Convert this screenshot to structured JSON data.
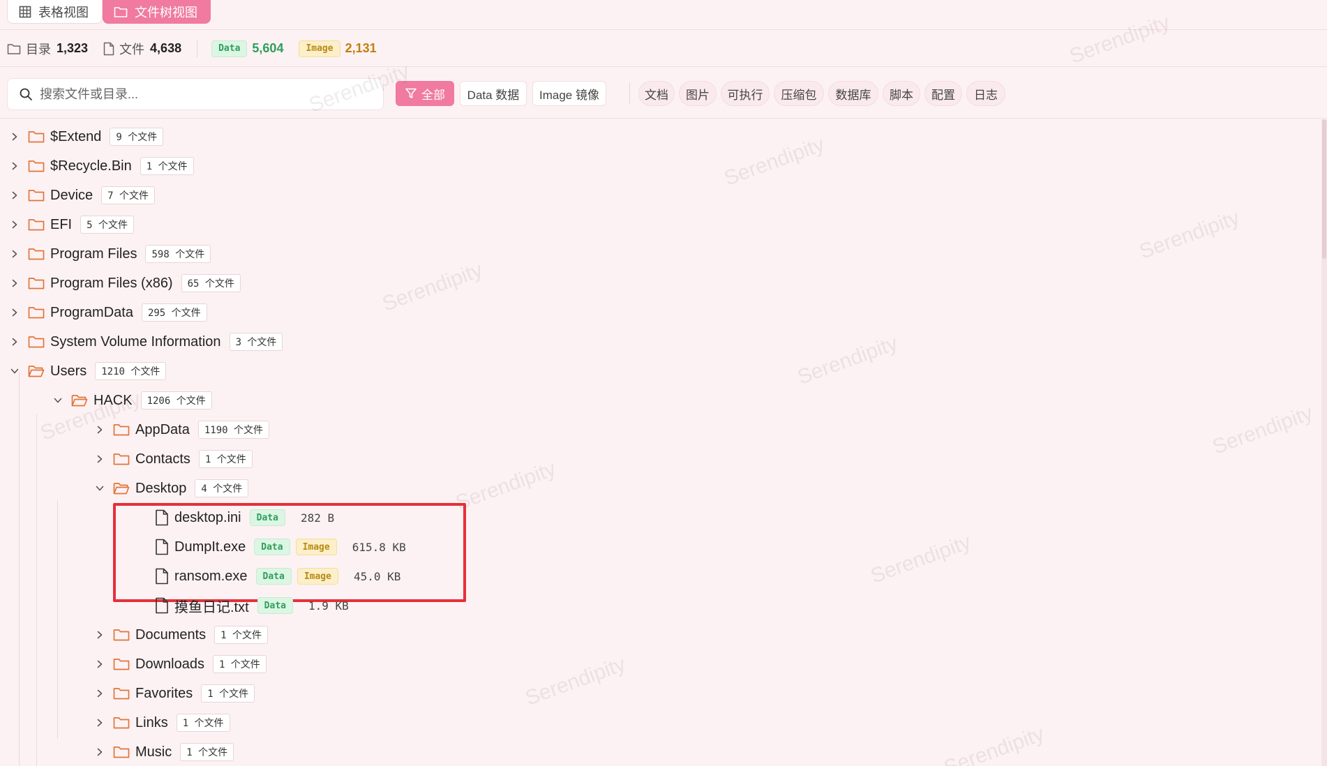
{
  "tabs": [
    {
      "label": "表格视图",
      "active": false
    },
    {
      "label": "文件树视图",
      "active": true
    }
  ],
  "stats": {
    "dir_label": "目录",
    "dir_count": "1,323",
    "file_label": "文件",
    "file_count": "4,638",
    "data_badge": "Data",
    "data_count": "5,604",
    "image_badge": "Image",
    "image_count": "2,131"
  },
  "search": {
    "placeholder": "搜索文件或目录..."
  },
  "filters": {
    "all": "全部",
    "data": "Data 数据",
    "image": "Image 镜像",
    "categories": [
      "文档",
      "图片",
      "可执行",
      "压缩包",
      "数据库",
      "脚本",
      "配置",
      "日志"
    ]
  },
  "tree": {
    "root_items": [
      {
        "name": "$Extend",
        "count": "9 个文件",
        "expanded": false
      },
      {
        "name": "$Recycle.Bin",
        "count": "1 个文件",
        "expanded": false
      },
      {
        "name": "Device",
        "count": "7 个文件",
        "expanded": false
      },
      {
        "name": "EFI",
        "count": "5 个文件",
        "expanded": false
      },
      {
        "name": "Program Files",
        "count": "598 个文件",
        "expanded": false
      },
      {
        "name": "Program Files (x86)",
        "count": "65 个文件",
        "expanded": false
      },
      {
        "name": "ProgramData",
        "count": "295 个文件",
        "expanded": false
      },
      {
        "name": "System Volume Information",
        "count": "3 个文件",
        "expanded": false
      },
      {
        "name": "Users",
        "count": "1210 个文件",
        "expanded": true
      }
    ],
    "hack": {
      "name": "HACK",
      "count": "1206 个文件",
      "expanded": true
    },
    "hack_children": [
      {
        "name": "AppData",
        "count": "1190 个文件",
        "expanded": false
      },
      {
        "name": "Contacts",
        "count": "1 个文件",
        "expanded": false
      },
      {
        "name": "Desktop",
        "count": "4 个文件",
        "expanded": true
      },
      {
        "name": "Documents",
        "count": "1 个文件",
        "expanded": false
      },
      {
        "name": "Downloads",
        "count": "1 个文件",
        "expanded": false
      },
      {
        "name": "Favorites",
        "count": "1 个文件",
        "expanded": false
      },
      {
        "name": "Links",
        "count": "1 个文件",
        "expanded": false
      },
      {
        "name": "Music",
        "count": "1 个文件",
        "expanded": false
      }
    ],
    "desktop_files": [
      {
        "name": "desktop.ini",
        "tags": [
          "Data"
        ],
        "size": "282 B"
      },
      {
        "name": "DumpIt.exe",
        "tags": [
          "Data",
          "Image"
        ],
        "size": "615.8 KB"
      },
      {
        "name": "ransom.exe",
        "tags": [
          "Data",
          "Image"
        ],
        "size": "45.0 KB"
      },
      {
        "name": "摸鱼日记.txt",
        "tags": [
          "Data"
        ],
        "size": "1.9 KB"
      }
    ]
  },
  "watermark": "Serendipity",
  "colors": {
    "accent": "#f07aa0",
    "data": "#2f9e5a",
    "image": "#c17f0e",
    "highlight": "#e5303a"
  }
}
